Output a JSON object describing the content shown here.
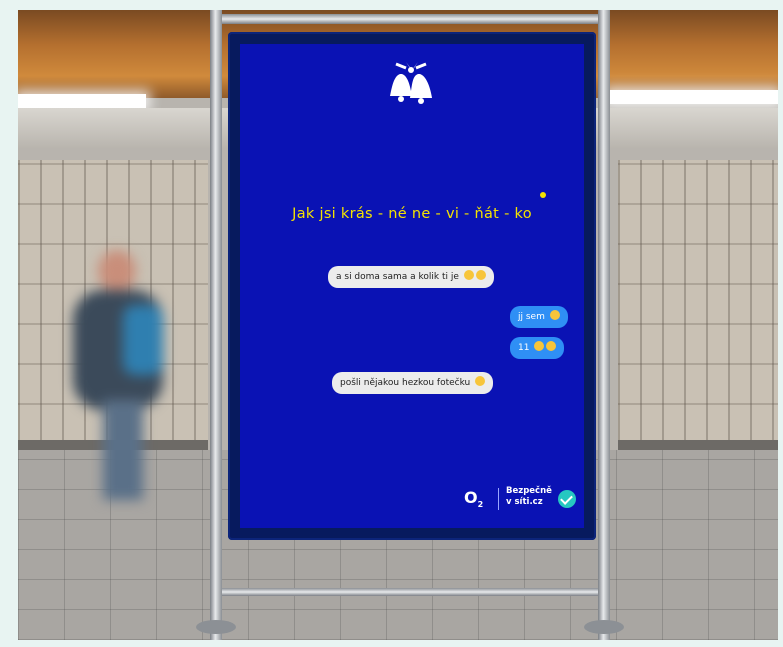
{
  "poster": {
    "headline": "Jak  jsi  krás - né  ne - vi - ňát - ko",
    "messages": [
      {
        "text": "a si doma sama a kolik ti je",
        "side": "received"
      },
      {
        "text": "jj sem",
        "side": "sent"
      },
      {
        "text": "11",
        "side": "sent"
      },
      {
        "text": "pošli nějakou hezkou fotečku",
        "side": "received"
      }
    ],
    "brand": {
      "logo": "O",
      "logo_sub": "2",
      "tagline_1": "Bezpečně",
      "tagline_2": "v síti.cz"
    },
    "icons": [
      "bells-icon",
      "emoji-icon",
      "check-icon"
    ]
  },
  "colors": {
    "poster_bg": "#0a12b4",
    "headline": "#f4e300",
    "bubble_received": "#ececec",
    "bubble_sent": "#2f8ff5",
    "check": "#26c7c1"
  }
}
